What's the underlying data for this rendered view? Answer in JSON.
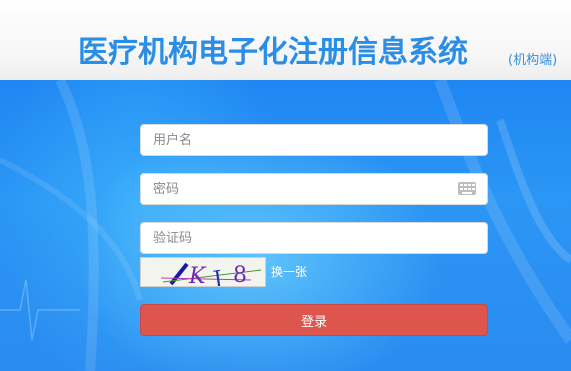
{
  "header": {
    "title": "医疗机构电子化注册信息系统",
    "subtitle": "(机构端)"
  },
  "form": {
    "username_placeholder": "用户名",
    "password_placeholder": "密码",
    "captcha_placeholder": "验证码",
    "captcha_text": "K J 8",
    "refresh_label": "换一张",
    "login_label": "登录"
  },
  "colors": {
    "title": "#2a8ee6",
    "background": "#2b96f5",
    "login_button": "#de554e"
  },
  "icons": {
    "keyboard": "keyboard-icon"
  }
}
